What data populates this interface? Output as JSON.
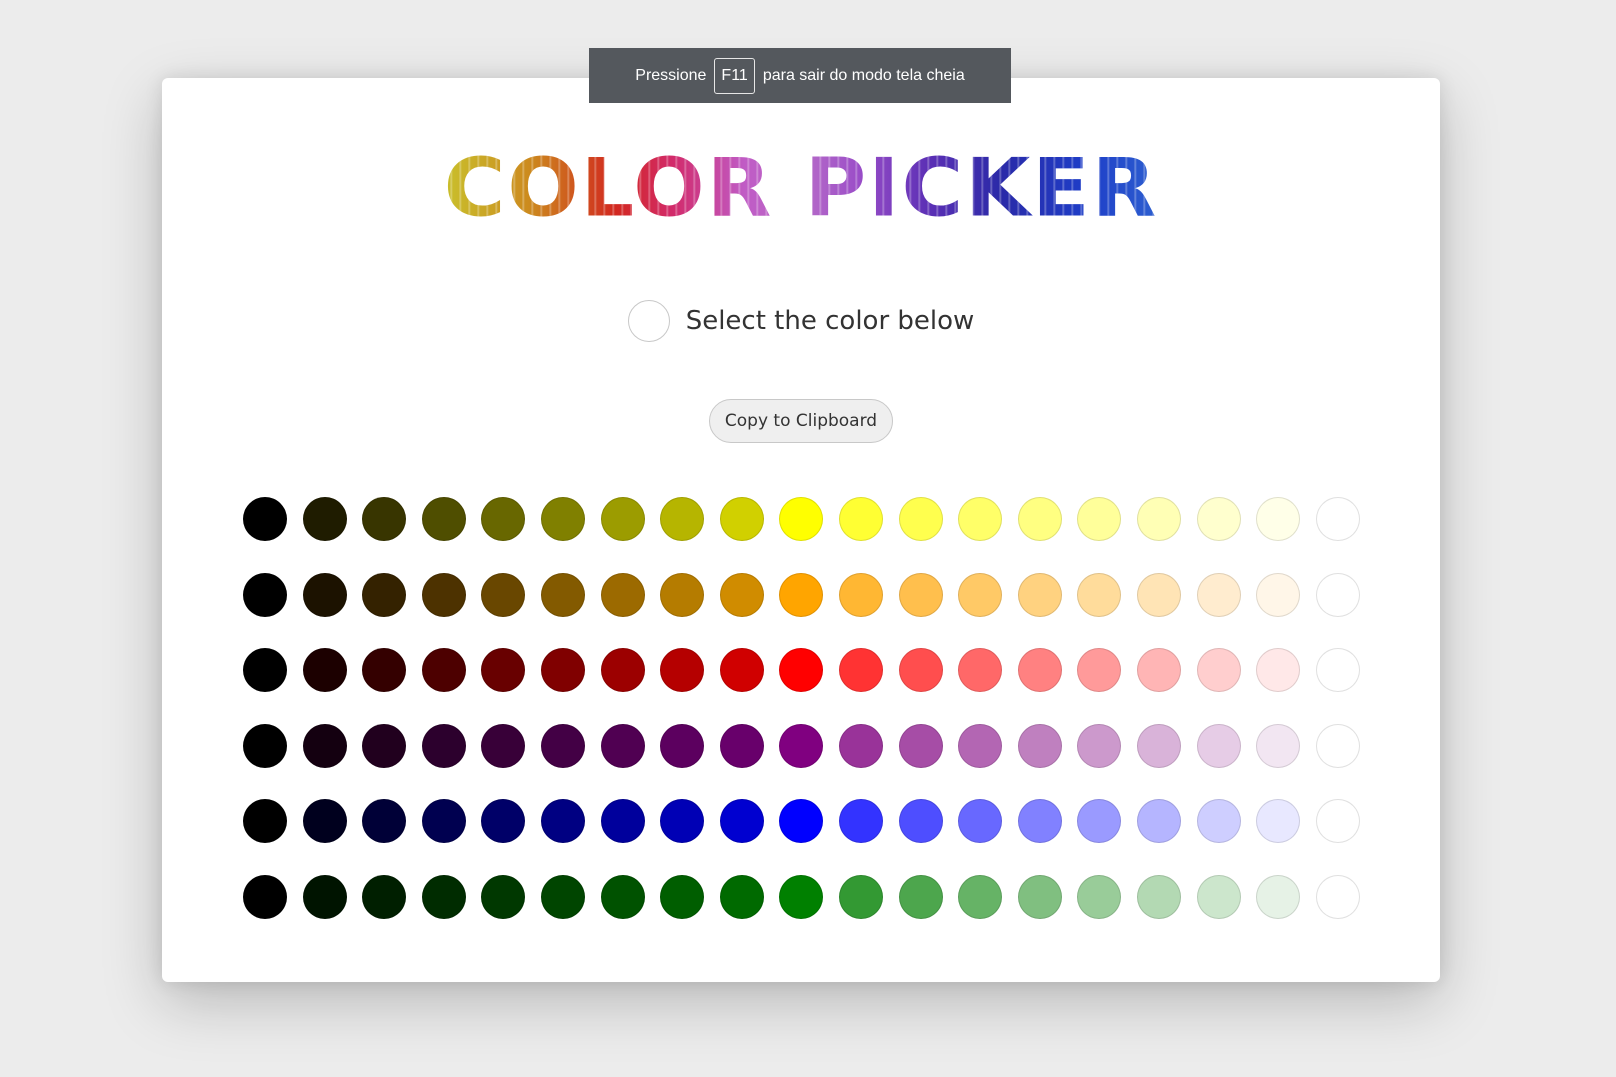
{
  "fullscreen_notice": {
    "prefix": "Pressione",
    "key": "F11",
    "suffix": "para sair do modo tela cheia"
  },
  "title": "COLOR PICKER",
  "selector": {
    "label": "Select the color below",
    "selected_color": "#ffffff"
  },
  "copy_button": {
    "label": "Copy to Clipboard"
  },
  "palette": [
    [
      "#000000",
      "#1f1c00",
      "#383500",
      "#4f4e00",
      "#686700",
      "#808000",
      "#9c9c00",
      "#b6b500",
      "#d1d000",
      "#ffff00",
      "#ffff33",
      "#ffff4e",
      "#ffff68",
      "#ffff81",
      "#ffff9a",
      "#ffffb5",
      "#ffffce",
      "#ffffe8",
      "#ffffff"
    ],
    [
      "#000000",
      "#1c1200",
      "#342200",
      "#4d3200",
      "#694700",
      "#835a00",
      "#9c6a00",
      "#b57c00",
      "#d08c00",
      "#ffa500",
      "#ffb733",
      "#ffbf4d",
      "#ffc966",
      "#ffd280",
      "#ffdc9b",
      "#ffe4b5",
      "#ffeccf",
      "#fff6e8",
      "#ffffff"
    ],
    [
      "#000000",
      "#1c0000",
      "#340000",
      "#4d0000",
      "#680000",
      "#800000",
      "#9c0000",
      "#b50000",
      "#d00000",
      "#ff0000",
      "#ff3333",
      "#ff4e4e",
      "#ff6868",
      "#ff8181",
      "#ff9a9a",
      "#ffb5b5",
      "#ffcece",
      "#ffe8e8",
      "#ffffff"
    ],
    [
      "#000000",
      "#140010",
      "#21001e",
      "#2c002d",
      "#380038",
      "#430045",
      "#500052",
      "#5c005f",
      "#68006b",
      "#800080",
      "#993399",
      "#a64da6",
      "#b366b3",
      "#bf80bf",
      "#cc99cc",
      "#d9b3d9",
      "#e6cce6",
      "#f2e6f2",
      "#ffffff"
    ],
    [
      "#000000",
      "#00001e",
      "#000037",
      "#000050",
      "#000068",
      "#000082",
      "#00009c",
      "#0000b5",
      "#0000d0",
      "#0000ff",
      "#3333ff",
      "#4e4eff",
      "#6868ff",
      "#8181ff",
      "#9a9aff",
      "#b5b5ff",
      "#ceceff",
      "#e8e8ff",
      "#ffffff"
    ],
    [
      "#000000",
      "#001400",
      "#001f00",
      "#002c00",
      "#003800",
      "#004500",
      "#005200",
      "#005e00",
      "#006a00",
      "#008000",
      "#339933",
      "#4da64d",
      "#66b366",
      "#80bf80",
      "#99cc99",
      "#b3d9b3",
      "#cce6cc",
      "#e6f2e6",
      "#ffffff"
    ]
  ]
}
